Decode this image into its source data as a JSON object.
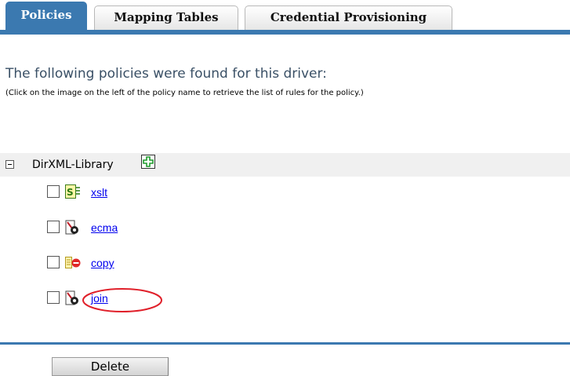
{
  "tabs": [
    {
      "label": "Policies",
      "active": true
    },
    {
      "label": "Mapping Tables",
      "active": false
    },
    {
      "label": "Credential Provisioning",
      "active": false
    }
  ],
  "heading": "The following policies were found for this driver:",
  "subheading": "(Click on the image on the left of the policy name to retrieve the list of rules for the policy.)",
  "library": {
    "name": "DirXML-Library",
    "expanded": true,
    "add_icon": "add-plus-icon"
  },
  "policies": [
    {
      "name": "xslt",
      "icon": "stylesheet-icon",
      "checked": false
    },
    {
      "name": "ecma",
      "icon": "ecma-script-icon",
      "checked": false
    },
    {
      "name": "copy",
      "icon": "copy-policy-icon",
      "checked": false
    },
    {
      "name": "join",
      "icon": "ecma-script-icon",
      "checked": false,
      "highlighted": true
    }
  ],
  "actions": {
    "delete_label": "Delete"
  },
  "colors": {
    "accent": "#3b79b0",
    "link": "#0000ee",
    "highlight": "#e0202a"
  }
}
